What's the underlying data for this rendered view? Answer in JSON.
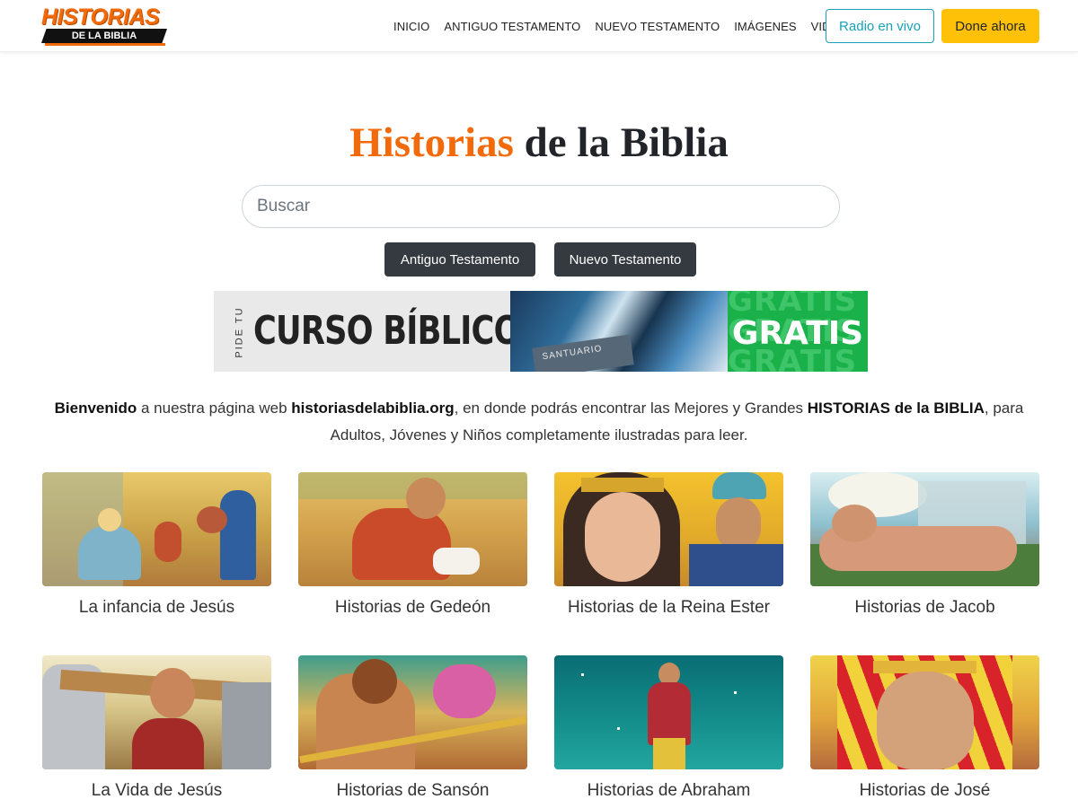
{
  "header": {
    "logo_top": "HISTORIAS",
    "logo_bottom": "DE LA BIBLIA",
    "nav": [
      "INICIO",
      "ANTIGUO TESTAMENTO",
      "NUEVO TESTAMENTO",
      "IMÁGENES",
      "VIDEOS"
    ],
    "radio_label": "Radio en vivo",
    "donate_label": "Done ahora"
  },
  "hero": {
    "title_accent": "Historias",
    "title_rest": " de la Biblia",
    "search_placeholder": "Buscar",
    "buttons": [
      "Antiguo Testamento",
      "Nuevo Testamento"
    ]
  },
  "banner": {
    "pide": "PIDE TU",
    "curso": "CURSO BÍBLICO",
    "book_text": "SANTUARIO",
    "gratis": "GRATIS"
  },
  "welcome": {
    "p1_bold": "Bienvenido",
    "p2": " a nuestra página web ",
    "p3_bold": "historiasdelabiblia.org",
    "p4": ", en donde podrás encontrar las Mejores y Grandes ",
    "p5_bold": "HISTORIAS de la BIBLIA",
    "p6": ", para Adultos, Jóvenes y Niños completamente ilustradas para leer."
  },
  "cards": [
    {
      "label": "La infancia de Jesús"
    },
    {
      "label": "Historias de Gedeón"
    },
    {
      "label": "Historias de la Reina Ester"
    },
    {
      "label": "Historias de Jacob"
    },
    {
      "label": "La Vida de Jesús"
    },
    {
      "label": "Historias de Sansón"
    },
    {
      "label": "Historias de Abraham"
    },
    {
      "label": "Historias de José"
    }
  ],
  "colors": {
    "brand_orange": "#f26a0a",
    "radio_teal": "#17a2b8",
    "donate_yellow": "#ffc107",
    "dark_button": "#343a40",
    "banner_green": "#1bb14a"
  }
}
